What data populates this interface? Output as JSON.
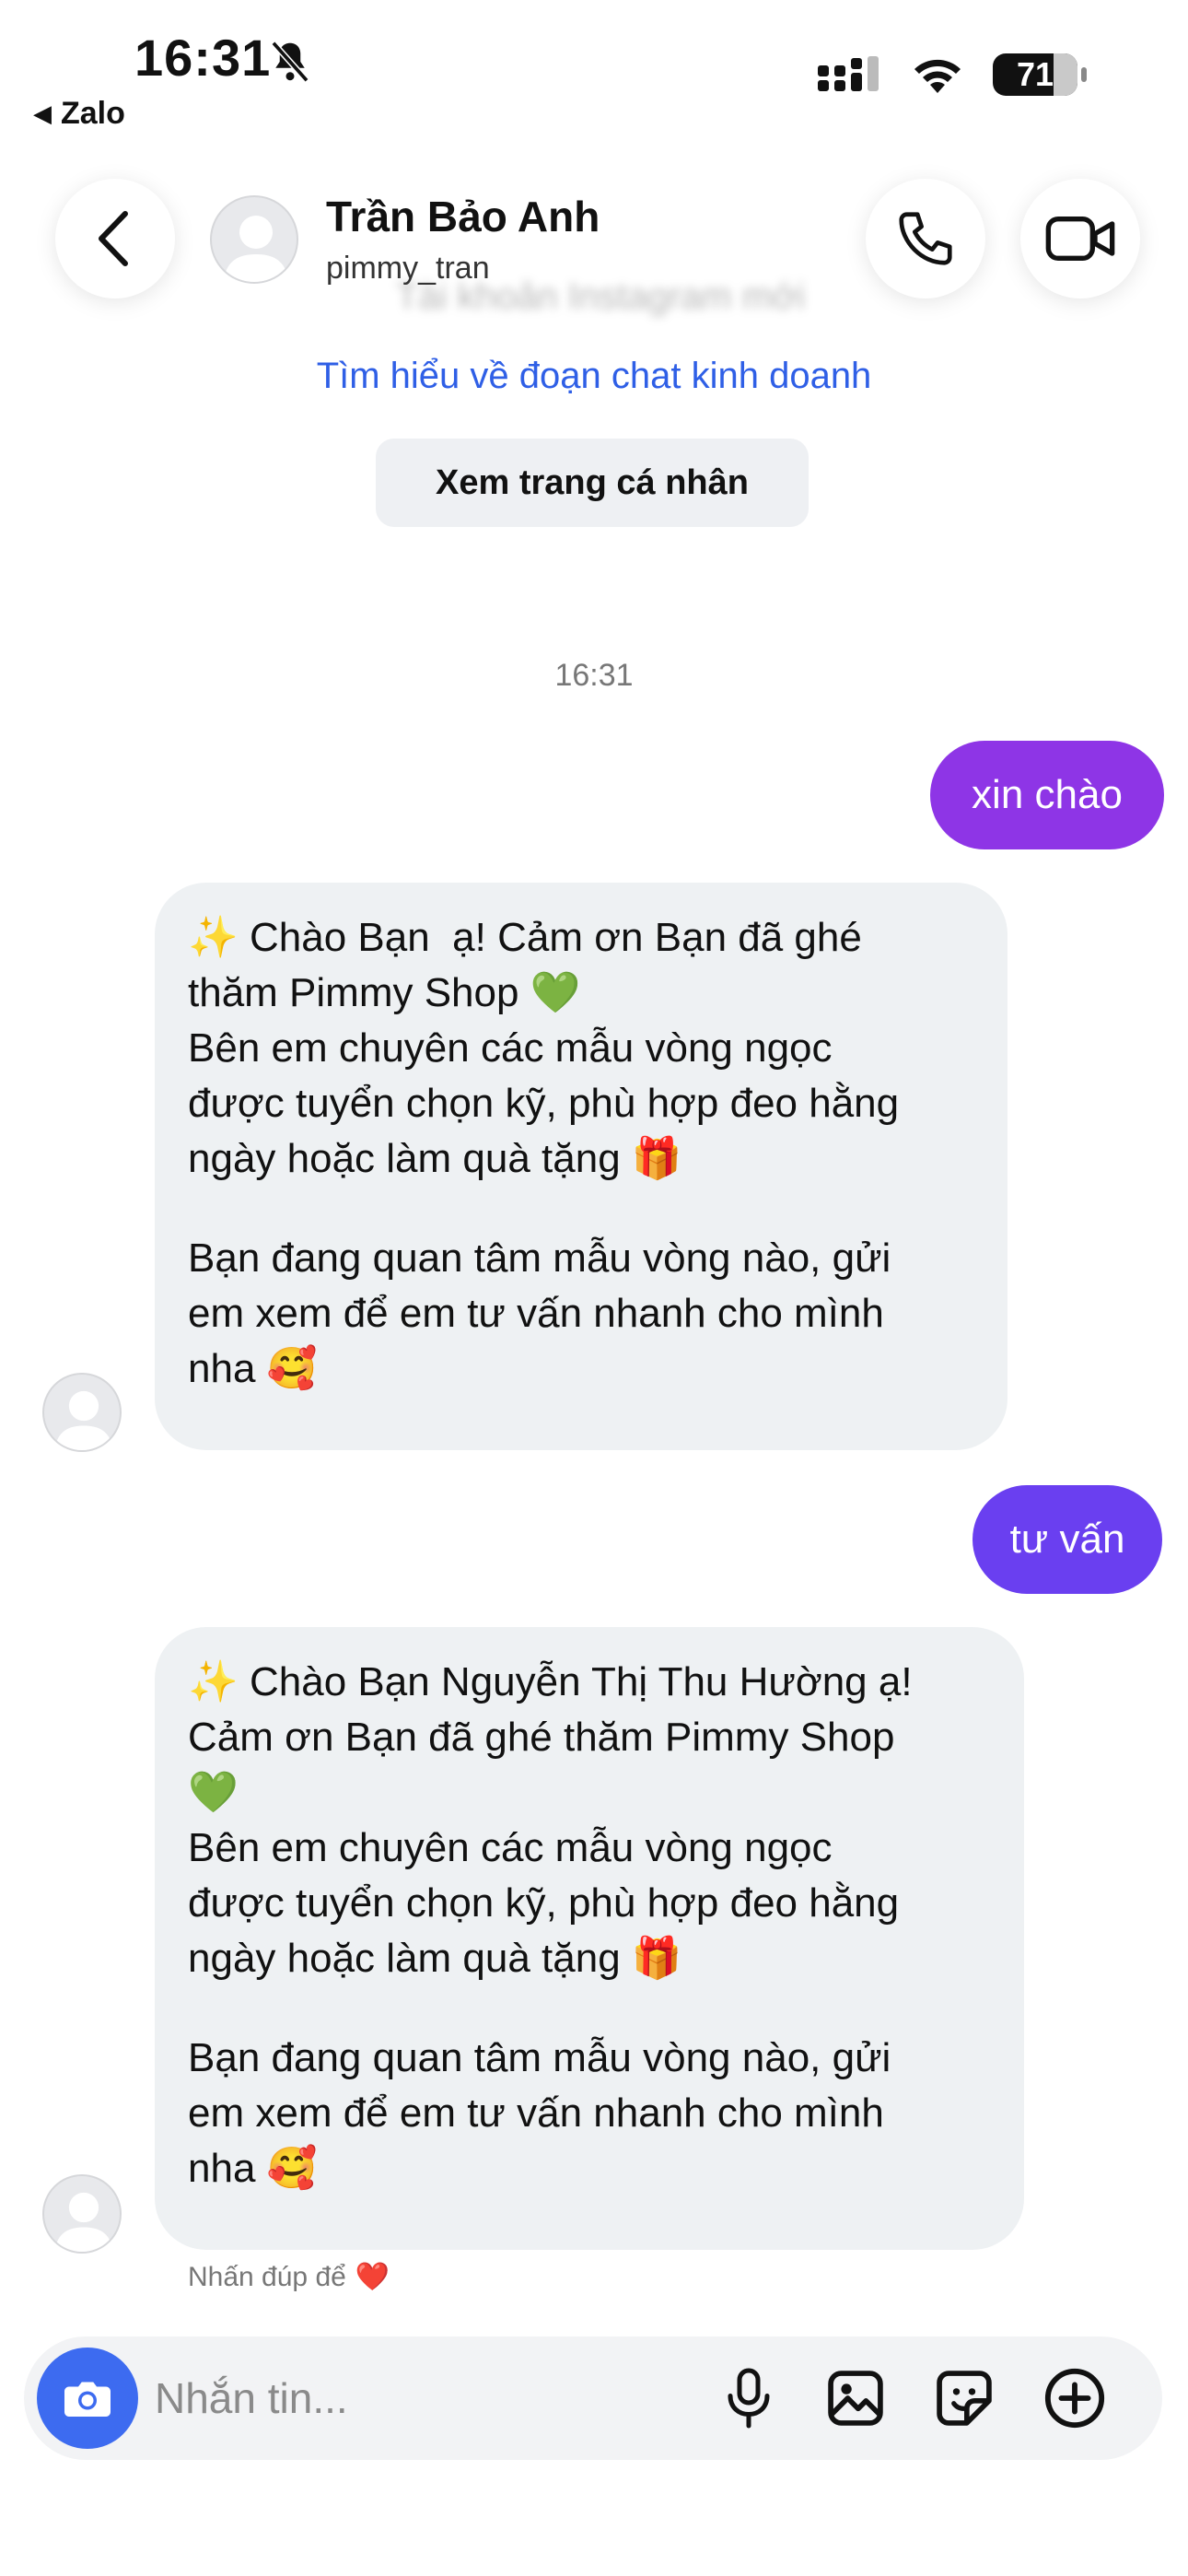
{
  "status_bar": {
    "time": "16:31",
    "back_app": "Zalo",
    "battery": "71"
  },
  "header": {
    "contact_name": "Trần Bảo Anh",
    "contact_handle": "pimmy_tran",
    "blurred_subtitle": "Tài khoản Instagram mới"
  },
  "info": {
    "learn_link": "Tìm hiểu về đoạn chat kinh doanh",
    "profile_button": "Xem trang cá nhân"
  },
  "chat": {
    "timestamp": "16:31",
    "out_message_1": "xin chào",
    "in_message_1": {
      "lines": [
        "✨ Chào Bạn  ạ! Cảm ơn Bạn đã ghé",
        "thăm Pimmy Shop 💚",
        "Bên em chuyên các mẫu vòng ngọc",
        "được tuyển chọn kỹ, phù hợp đeo hằng",
        "ngày hoặc làm quà tặng 🎁",
        "",
        "Bạn đang quan tâm mẫu vòng nào, gửi",
        "em xem để em tư vấn nhanh cho mình",
        "nha 🥰"
      ]
    },
    "out_message_2": "tư vấn",
    "in_message_2": {
      "lines": [
        "✨ Chào Bạn Nguyễn Thị Thu Hường ạ!",
        "Cảm ơn Bạn đã ghé thăm Pimmy Shop",
        "💚",
        "Bên em chuyên các mẫu vòng ngọc",
        "được tuyển chọn kỹ, phù hợp đeo hằng",
        "ngày hoặc làm quà tặng 🎁",
        "",
        "Bạn đang quan tâm mẫu vòng nào, gửi",
        "em xem để em tư vấn nhanh cho mình",
        "nha 🥰"
      ]
    },
    "double_tap_hint": "Nhấn đúp để",
    "double_tap_emoji": "❤️"
  },
  "composer": {
    "placeholder": "Nhắn tin..."
  },
  "colors": {
    "out_bubble_1": "#8e35e6",
    "out_bubble_2": "#6a3ff0",
    "in_bubble": "#eef1f3",
    "link": "#2f5fe6",
    "camera_button": "#3d6bf0"
  }
}
